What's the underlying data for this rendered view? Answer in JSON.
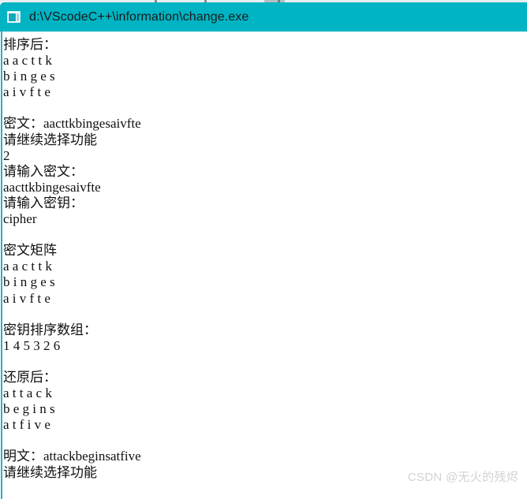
{
  "window": {
    "title": "d:\\VScodeC++\\information\\change.exe",
    "icon": "console-window-icon",
    "title_bar_color": "#00b4c4",
    "body_background": "#ffffff",
    "text_color": "#101010"
  },
  "console": {
    "lines": [
      "排序后：",
      "a a c t t k",
      "b i n g e s",
      "a i v f t e",
      "",
      "密文：aacttkbingesaivfte",
      "请继续选择功能",
      "2",
      "请输入密文：",
      "aacttkbingesaivfte",
      "请输入密钥：",
      "cipher",
      "",
      "密文矩阵",
      "a a c t t k",
      "b i n g e s",
      "a i v f t e",
      "",
      "密钥排序数组：",
      "1 4 5 3 2 6",
      "",
      "还原后：",
      "a t t a c k",
      "b e g i n s",
      "a t f i v e",
      "",
      "明文：attackbeginsatfive",
      "请继续选择功能"
    ]
  },
  "watermark": {
    "text": "CSDN @无火的残烬",
    "color": "#d2d2d2"
  }
}
